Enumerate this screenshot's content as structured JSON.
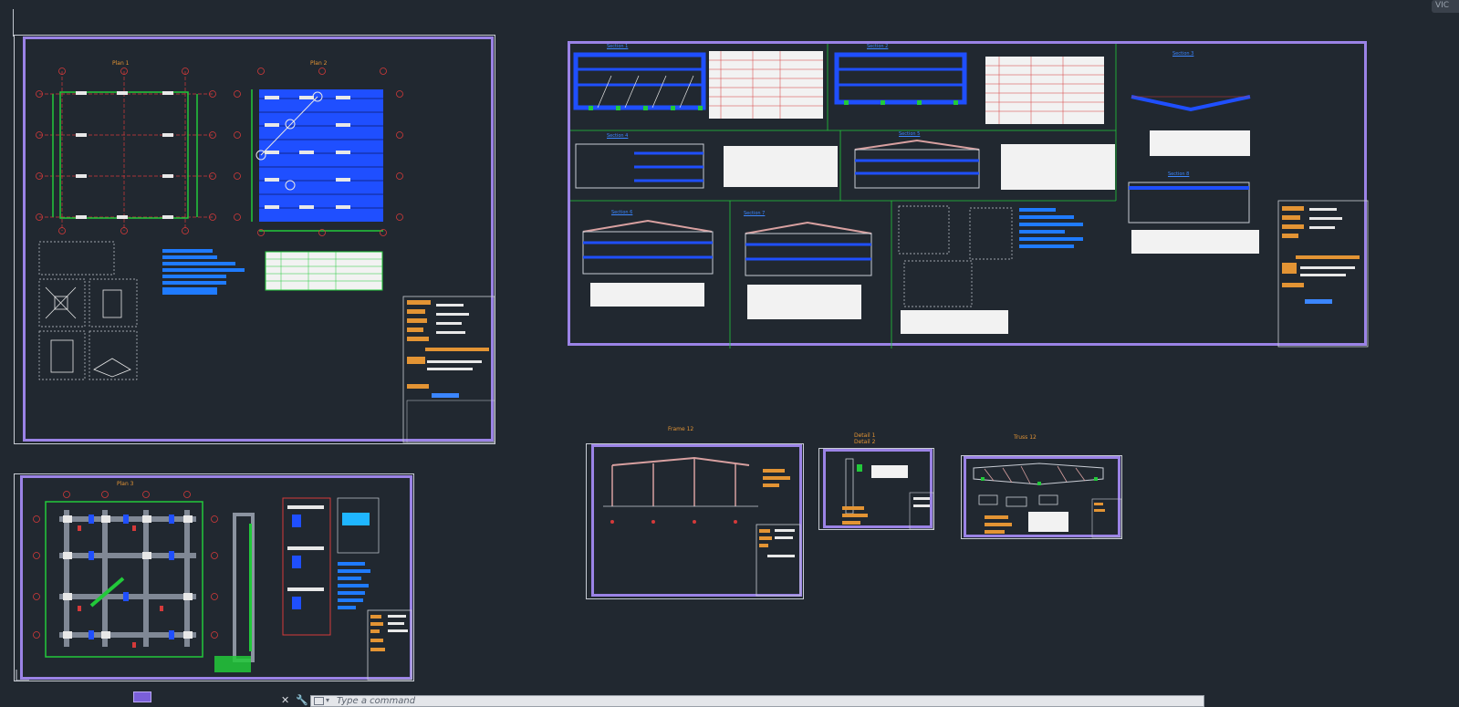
{
  "app": {
    "viewcube_label": "VIC",
    "command_placeholder": "Type a command"
  },
  "command_bar": {
    "close_icon": "close-icon",
    "settings_icon": "wrench-icon",
    "history_icon": "command-history-icon"
  },
  "sheets": [
    {
      "id": "sheet-1",
      "title_a": "Plan 1",
      "title_b": "Plan 2"
    },
    {
      "id": "sheet-2",
      "title": "Plan 3"
    },
    {
      "id": "sheet-3",
      "titles": [
        "Section 1",
        "Section 2",
        "Section 3",
        "Section 4",
        "Section 5",
        "Section 6",
        "Section 7",
        "Section 8"
      ]
    },
    {
      "id": "sheet-4",
      "caption": "Frame 12"
    },
    {
      "id": "sheet-5",
      "caption_a": "Detail 1",
      "caption_b": "Detail 2"
    },
    {
      "id": "sheet-6",
      "caption": "Truss 12"
    }
  ],
  "colors": {
    "background": "#212830",
    "sheet_border": "#9b83e6",
    "structure_blue": "#1f4fff",
    "grid_red": "#d53a3a",
    "green": "#22c93a",
    "orange": "#e39434",
    "white": "#e8e8e8"
  }
}
